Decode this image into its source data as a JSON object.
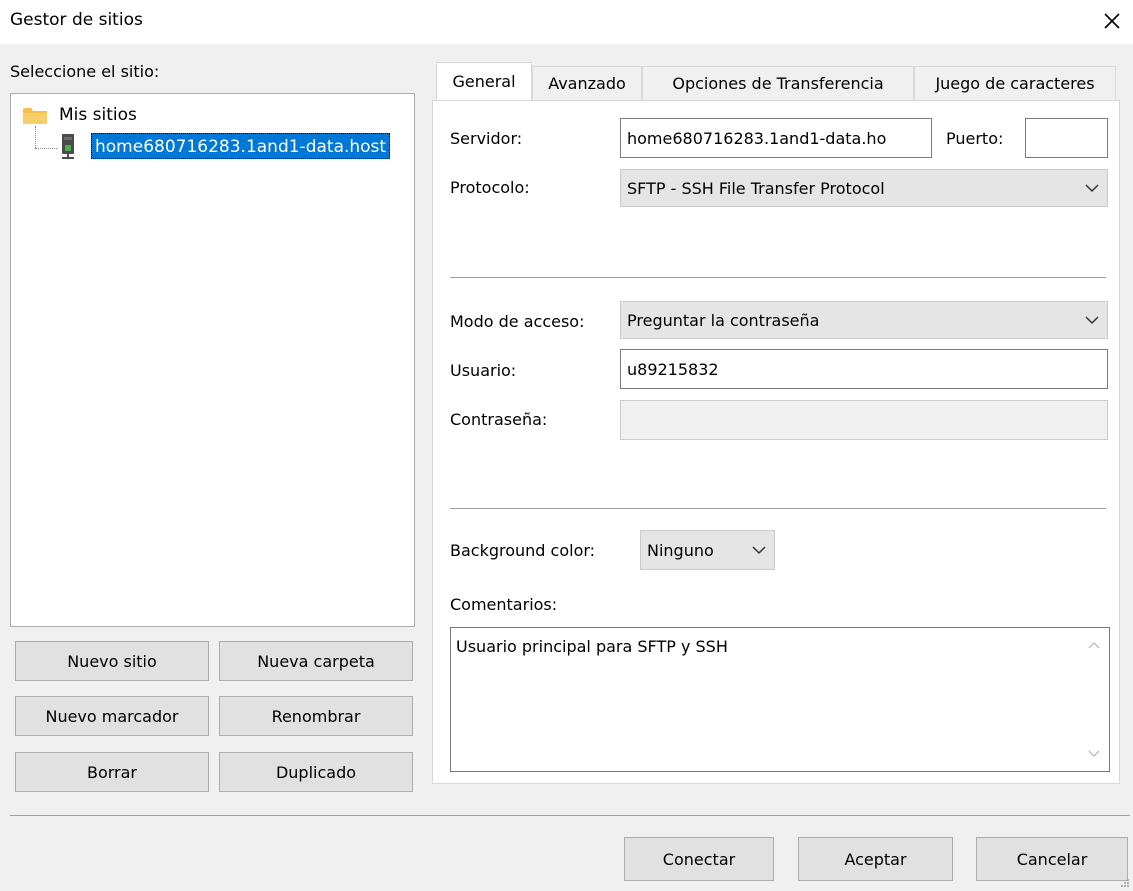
{
  "window": {
    "title": "Gestor de sitios"
  },
  "icons": {
    "close": "close-icon",
    "folder": "folder-icon",
    "server": "server-icon",
    "chevron": "chevron-down-icon",
    "scroll_up": "chevron-up-icon",
    "scroll_down": "chevron-down-icon"
  },
  "colors": {
    "selection": "#0078d7",
    "folder": "#f2c04b",
    "server": "#4caf50"
  },
  "site_tree": {
    "label": "Seleccione el sitio:",
    "root": "Mis sitios",
    "selected_site": "home680716283.1and1-data.host"
  },
  "site_buttons": {
    "new_site": "Nuevo sitio",
    "new_folder": "Nueva carpeta",
    "new_bookmark": "Nuevo marcador",
    "rename": "Renombrar",
    "delete": "Borrar",
    "duplicate": "Duplicado"
  },
  "tabs": [
    {
      "label": "General",
      "active": true
    },
    {
      "label": "Avanzado"
    },
    {
      "label": "Opciones de Transferencia"
    },
    {
      "label": "Juego de caracteres"
    }
  ],
  "general": {
    "server_label": "Servidor:",
    "server_value": "home680716283.1and1-data.ho",
    "port_label": "Puerto:",
    "port_value": "",
    "protocol_label": "Protocolo:",
    "protocol_value": "SFTP - SSH File Transfer Protocol",
    "access_mode_label": "Modo de acceso:",
    "access_mode_value": "Preguntar la contraseña",
    "user_label": "Usuario:",
    "user_value": "u89215832",
    "password_label": "Contraseña:",
    "password_value": "",
    "bg_color_label": "Background color:",
    "bg_color_value": "Ninguno",
    "comments_label": "Comentarios:",
    "comments_value": "Usuario principal para SFTP y SSH"
  },
  "footer": {
    "connect": "Conectar",
    "ok": "Aceptar",
    "cancel": "Cancelar"
  }
}
